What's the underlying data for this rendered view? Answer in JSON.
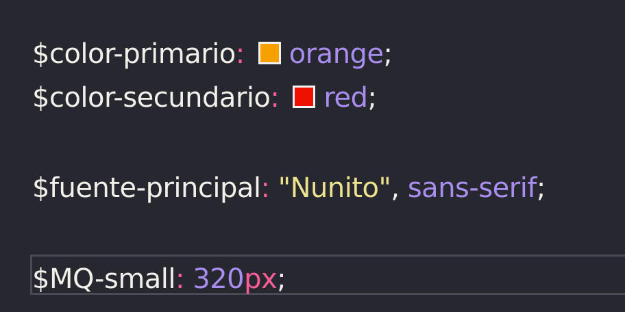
{
  "lines": {
    "primario": {
      "variable": "$color-primario",
      "colon": ":",
      "swatch_color": "#f7a100",
      "value": "orange",
      "semicolon": ";"
    },
    "secundario": {
      "variable": "$color-secundario",
      "colon": ":",
      "swatch_color": "#f01000",
      "value": "red",
      "semicolon": ";"
    },
    "fuente": {
      "variable": "$fuente-principal",
      "colon": ":",
      "string": "\"Nunito\"",
      "comma": ",",
      "value": "sans-serif",
      "semicolon": ";"
    },
    "mq": {
      "variable": "$MQ-small",
      "colon": ":",
      "number": "320",
      "unit": "px",
      "semicolon": ";"
    }
  }
}
